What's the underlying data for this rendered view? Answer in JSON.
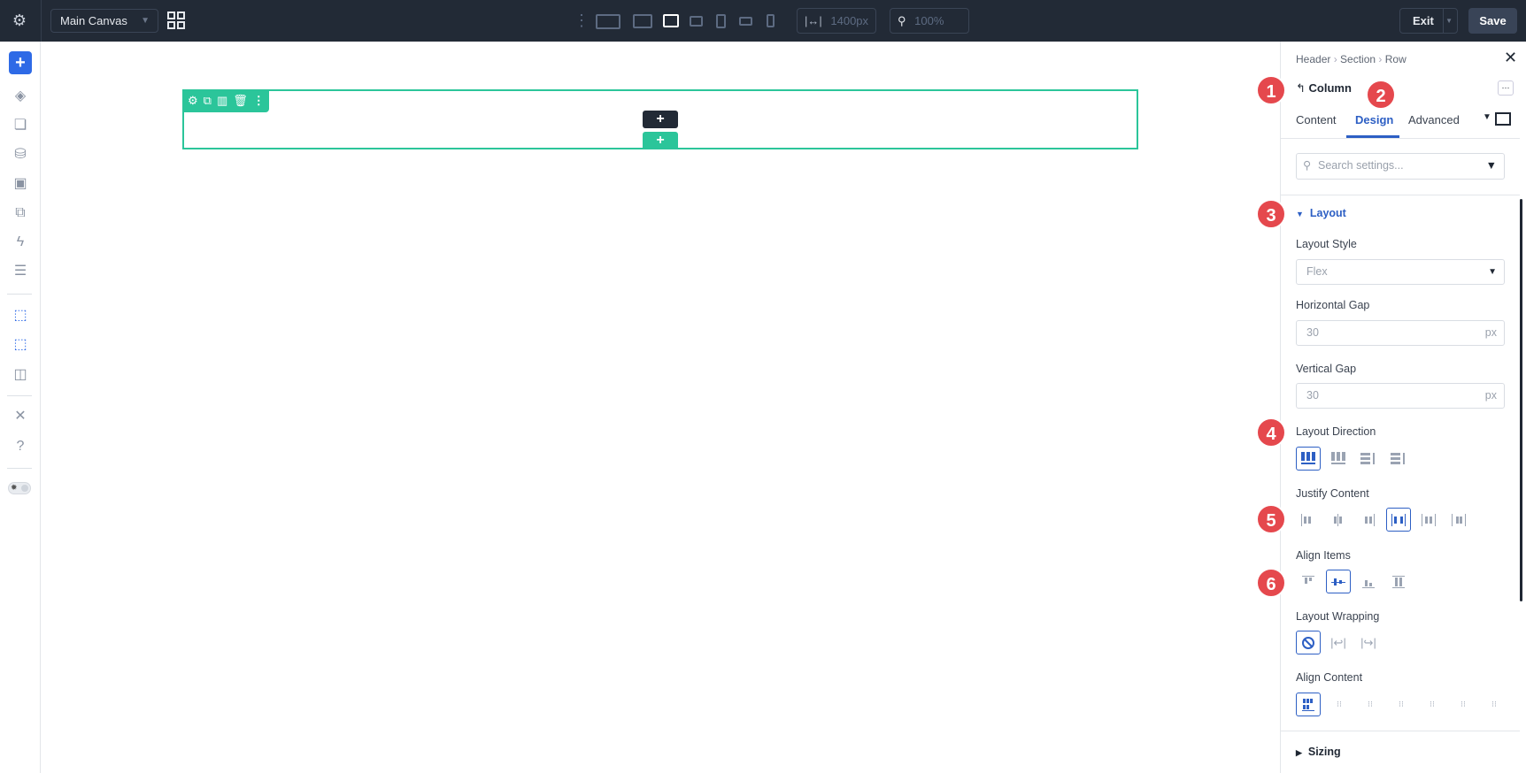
{
  "topbar": {
    "canvas_select": "Main Canvas",
    "width_value": "1400px",
    "zoom_value": "100%",
    "exit_label": "Exit",
    "save_label": "Save"
  },
  "canvas": {
    "add_module": "+",
    "add_row": "+"
  },
  "panel": {
    "breadcrumb": [
      "Header",
      "Section",
      "Row"
    ],
    "title": "Column",
    "tabs": [
      "Content",
      "Design",
      "Advanced"
    ],
    "active_tab": "Design",
    "search_placeholder": "Search settings...",
    "section_layout": "Layout",
    "layout_style_label": "Layout Style",
    "layout_style_value": "Flex",
    "hgap_label": "Horizontal Gap",
    "hgap_value": "30",
    "hgap_unit": "px",
    "vgap_label": "Vertical Gap",
    "vgap_value": "30",
    "vgap_unit": "px",
    "direction_label": "Layout Direction",
    "justify_label": "Justify Content",
    "align_items_label": "Align Items",
    "wrap_label": "Layout Wrapping",
    "align_content_label": "Align Content",
    "section_sizing": "Sizing",
    "badges": [
      "1",
      "2",
      "3",
      "4",
      "5",
      "6"
    ]
  },
  "colors": {
    "accent": "#2d5fc4",
    "green": "#2bc59a",
    "badge": "#e5484d",
    "topbar": "#222a36"
  }
}
